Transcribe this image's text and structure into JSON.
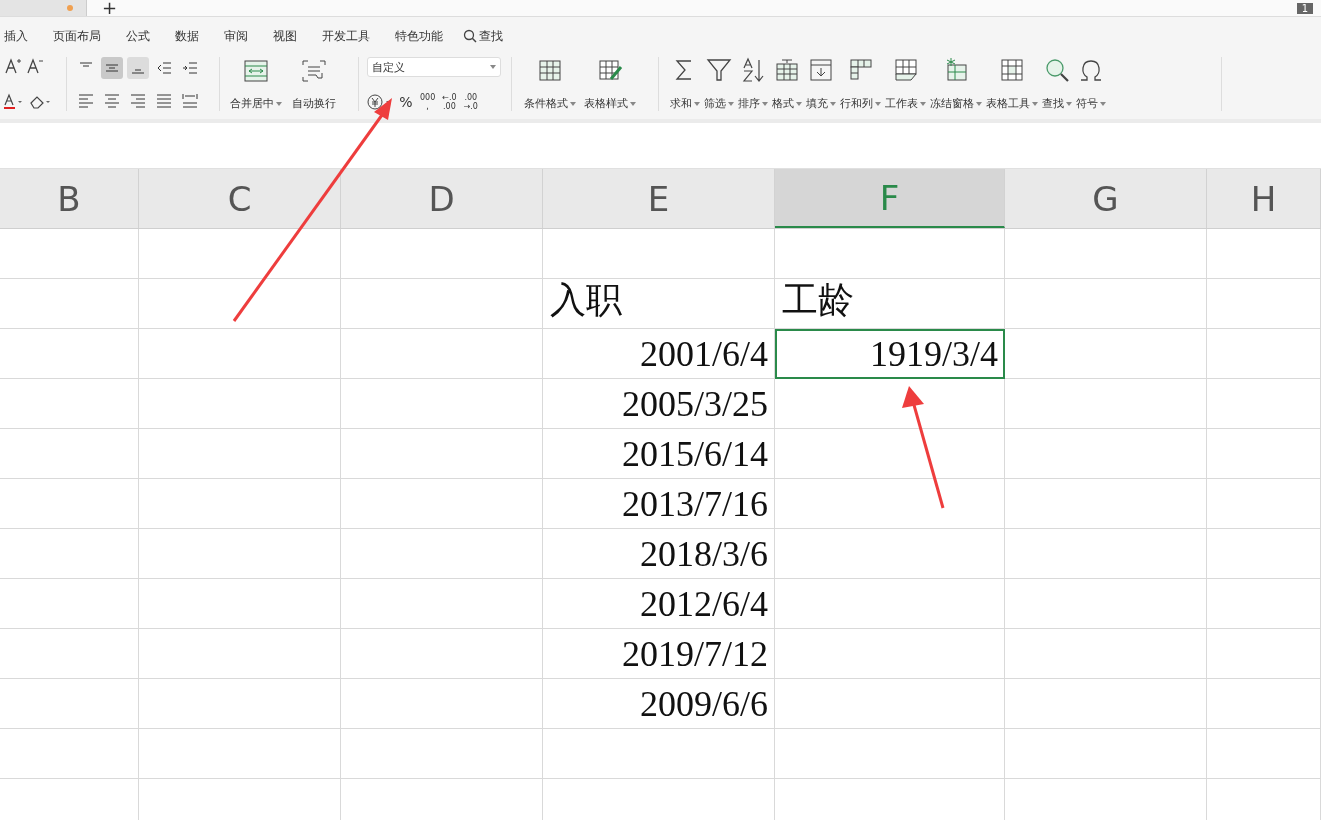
{
  "tab_strip": {
    "new_tab": "+",
    "page_badge": "1"
  },
  "menu": [
    {
      "label": "插入",
      "selected": false
    },
    {
      "label": "页面布局",
      "selected": false
    },
    {
      "label": "公式",
      "selected": false
    },
    {
      "label": "数据",
      "selected": false
    },
    {
      "label": "审阅",
      "selected": false
    },
    {
      "label": "视图",
      "selected": false
    },
    {
      "label": "开发工具",
      "selected": false
    },
    {
      "label": "特色功能",
      "selected": false
    }
  ],
  "menu_search": "查找",
  "alignment": {
    "top_selected": false,
    "middle_selected": true,
    "bottom_selected": true
  },
  "merge_buttons": [
    {
      "label": "合并居中",
      "dropdown": true,
      "kind": "merge"
    },
    {
      "label": "自动换行",
      "dropdown": false,
      "kind": "wrap"
    }
  ],
  "number_format": {
    "value": "自定义",
    "buttons": [
      "%",
      "000\n,",
      "←.0\n.00",
      ".00\n→.0"
    ]
  },
  "style_buttons": [
    {
      "label": "条件格式",
      "dropdown": true,
      "kind": "conditional"
    },
    {
      "label": "表格样式",
      "dropdown": true,
      "kind": "tablestyle"
    }
  ],
  "tool_buttons": [
    {
      "label": "求和",
      "dropdown": true,
      "kind": "sum"
    },
    {
      "label": "筛选",
      "dropdown": true,
      "kind": "filter"
    },
    {
      "label": "排序",
      "dropdown": true,
      "kind": "sort"
    },
    {
      "label": "格式",
      "dropdown": true,
      "kind": "format"
    },
    {
      "label": "填充",
      "dropdown": true,
      "kind": "fill"
    },
    {
      "label": "行和列",
      "dropdown": true,
      "kind": "rowcol"
    },
    {
      "label": "工作表",
      "dropdown": true,
      "kind": "sheet"
    },
    {
      "label": "冻结窗格",
      "dropdown": true,
      "kind": "freeze"
    },
    {
      "label": "表格工具",
      "dropdown": true,
      "kind": "tabletools"
    },
    {
      "label": "查找",
      "dropdown": true,
      "kind": "find"
    },
    {
      "label": "符号",
      "dropdown": true,
      "kind": "symbol"
    }
  ],
  "grid": {
    "columns": [
      {
        "label": "B",
        "selected": false
      },
      {
        "label": "C",
        "selected": false
      },
      {
        "label": "D",
        "selected": false
      },
      {
        "label": "E",
        "selected": false
      },
      {
        "label": "F",
        "selected": true
      },
      {
        "label": "G",
        "selected": false
      },
      {
        "label": "H",
        "selected": false
      }
    ],
    "rows": [
      {},
      {
        "E": {
          "text": "入职",
          "kind": "text",
          "selected": false
        },
        "F": {
          "text": "工龄",
          "kind": "text",
          "selected": false
        }
      },
      {
        "E": {
          "text": "2001/6/4",
          "kind": "date",
          "selected": false
        },
        "F": {
          "text": "1919/3/4",
          "kind": "date",
          "selected": true
        }
      },
      {
        "E": {
          "text": "2005/3/25",
          "kind": "date",
          "selected": false
        }
      },
      {
        "E": {
          "text": "2015/6/14",
          "kind": "date",
          "selected": false
        }
      },
      {
        "E": {
          "text": "2013/7/16",
          "kind": "date",
          "selected": false
        }
      },
      {
        "E": {
          "text": "2018/3/6",
          "kind": "date",
          "selected": false
        }
      },
      {
        "E": {
          "text": "2012/6/4",
          "kind": "date",
          "selected": false
        }
      },
      {
        "E": {
          "text": "2019/7/12",
          "kind": "date",
          "selected": false
        }
      },
      {
        "E": {
          "text": "2009/6/6",
          "kind": "date",
          "selected": false
        }
      },
      {},
      {}
    ]
  }
}
